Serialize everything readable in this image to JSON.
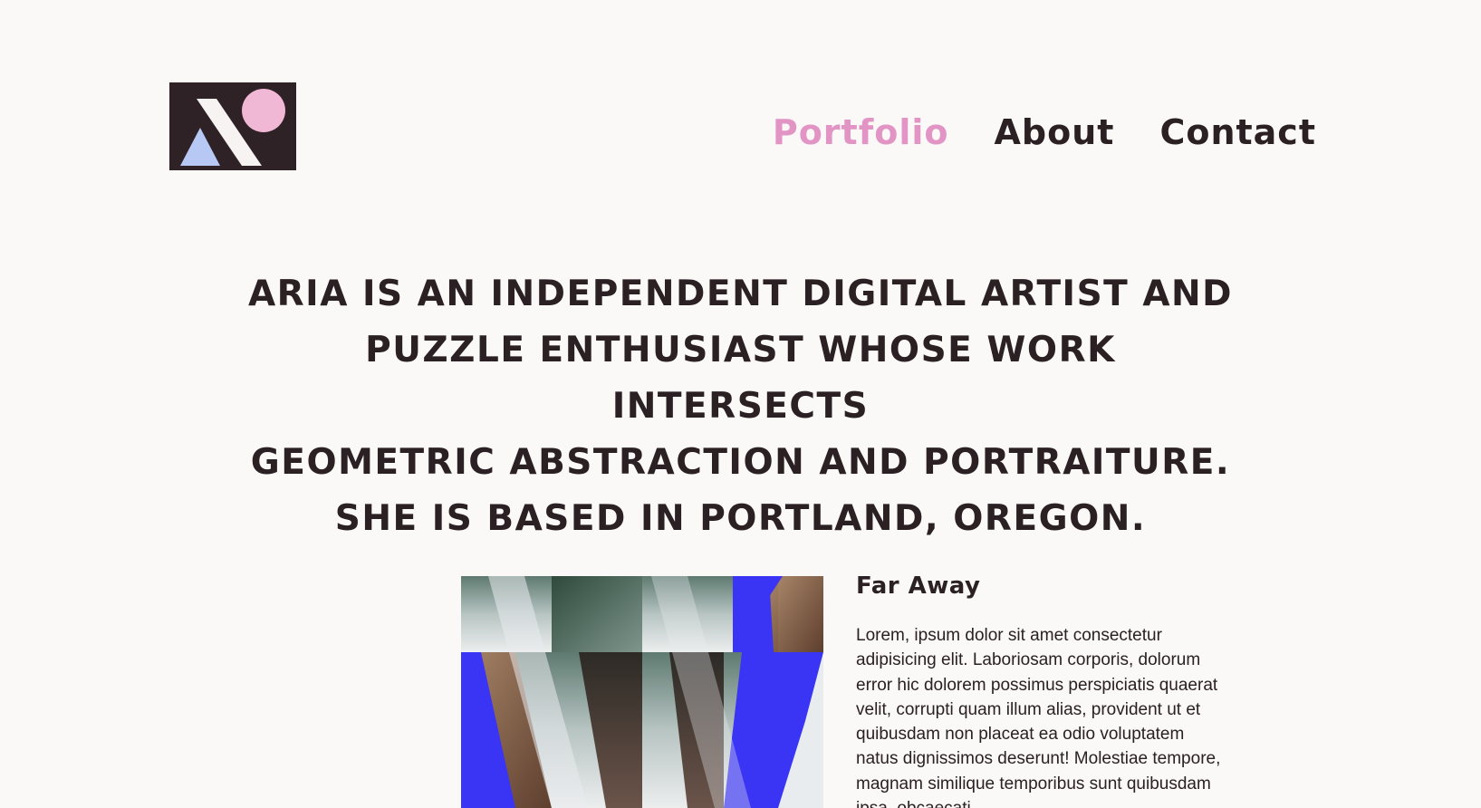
{
  "logo": {
    "icon": "logo-mark-icon",
    "colors": {
      "background": "#2e2226",
      "circle": "#f0b8d4",
      "triangle": "#b8c8f4",
      "stripe": "#ffffff"
    }
  },
  "nav": {
    "items": [
      {
        "label": "Portfolio",
        "active": true
      },
      {
        "label": "About",
        "active": false
      },
      {
        "label": "Contact",
        "active": false
      }
    ],
    "active_color": "#e294c4"
  },
  "hero": {
    "lines": [
      "ARIA IS AN INDEPENDENT DIGITAL ARTIST AND",
      "PUZZLE ENTHUSIAST WHOSE WORK INTERSECTS",
      "GEOMETRIC ABSTRACTION AND PORTRAITURE.",
      "SHE IS BASED IN PORTLAND, OREGON."
    ]
  },
  "portfolio": {
    "items": [
      {
        "title": "Far Away",
        "description": "Lorem, ipsum dolor sit amet consectetur adipisicing elit. Laboriosam corporis, dolorum error hic dolorem possimus perspiciatis quaerat velit, corrupti quam illum alias, provident ut et quibusdam non placeat ea odio voluptatem natus dignissimos deserunt! Molestiae tempore, magnam similique temporibus sunt quibusdam ipsa, obcaecati",
        "accent_color": "#3a34f4"
      }
    ]
  },
  "colors": {
    "background": "#faf9f7",
    "text": "#2b2024"
  }
}
